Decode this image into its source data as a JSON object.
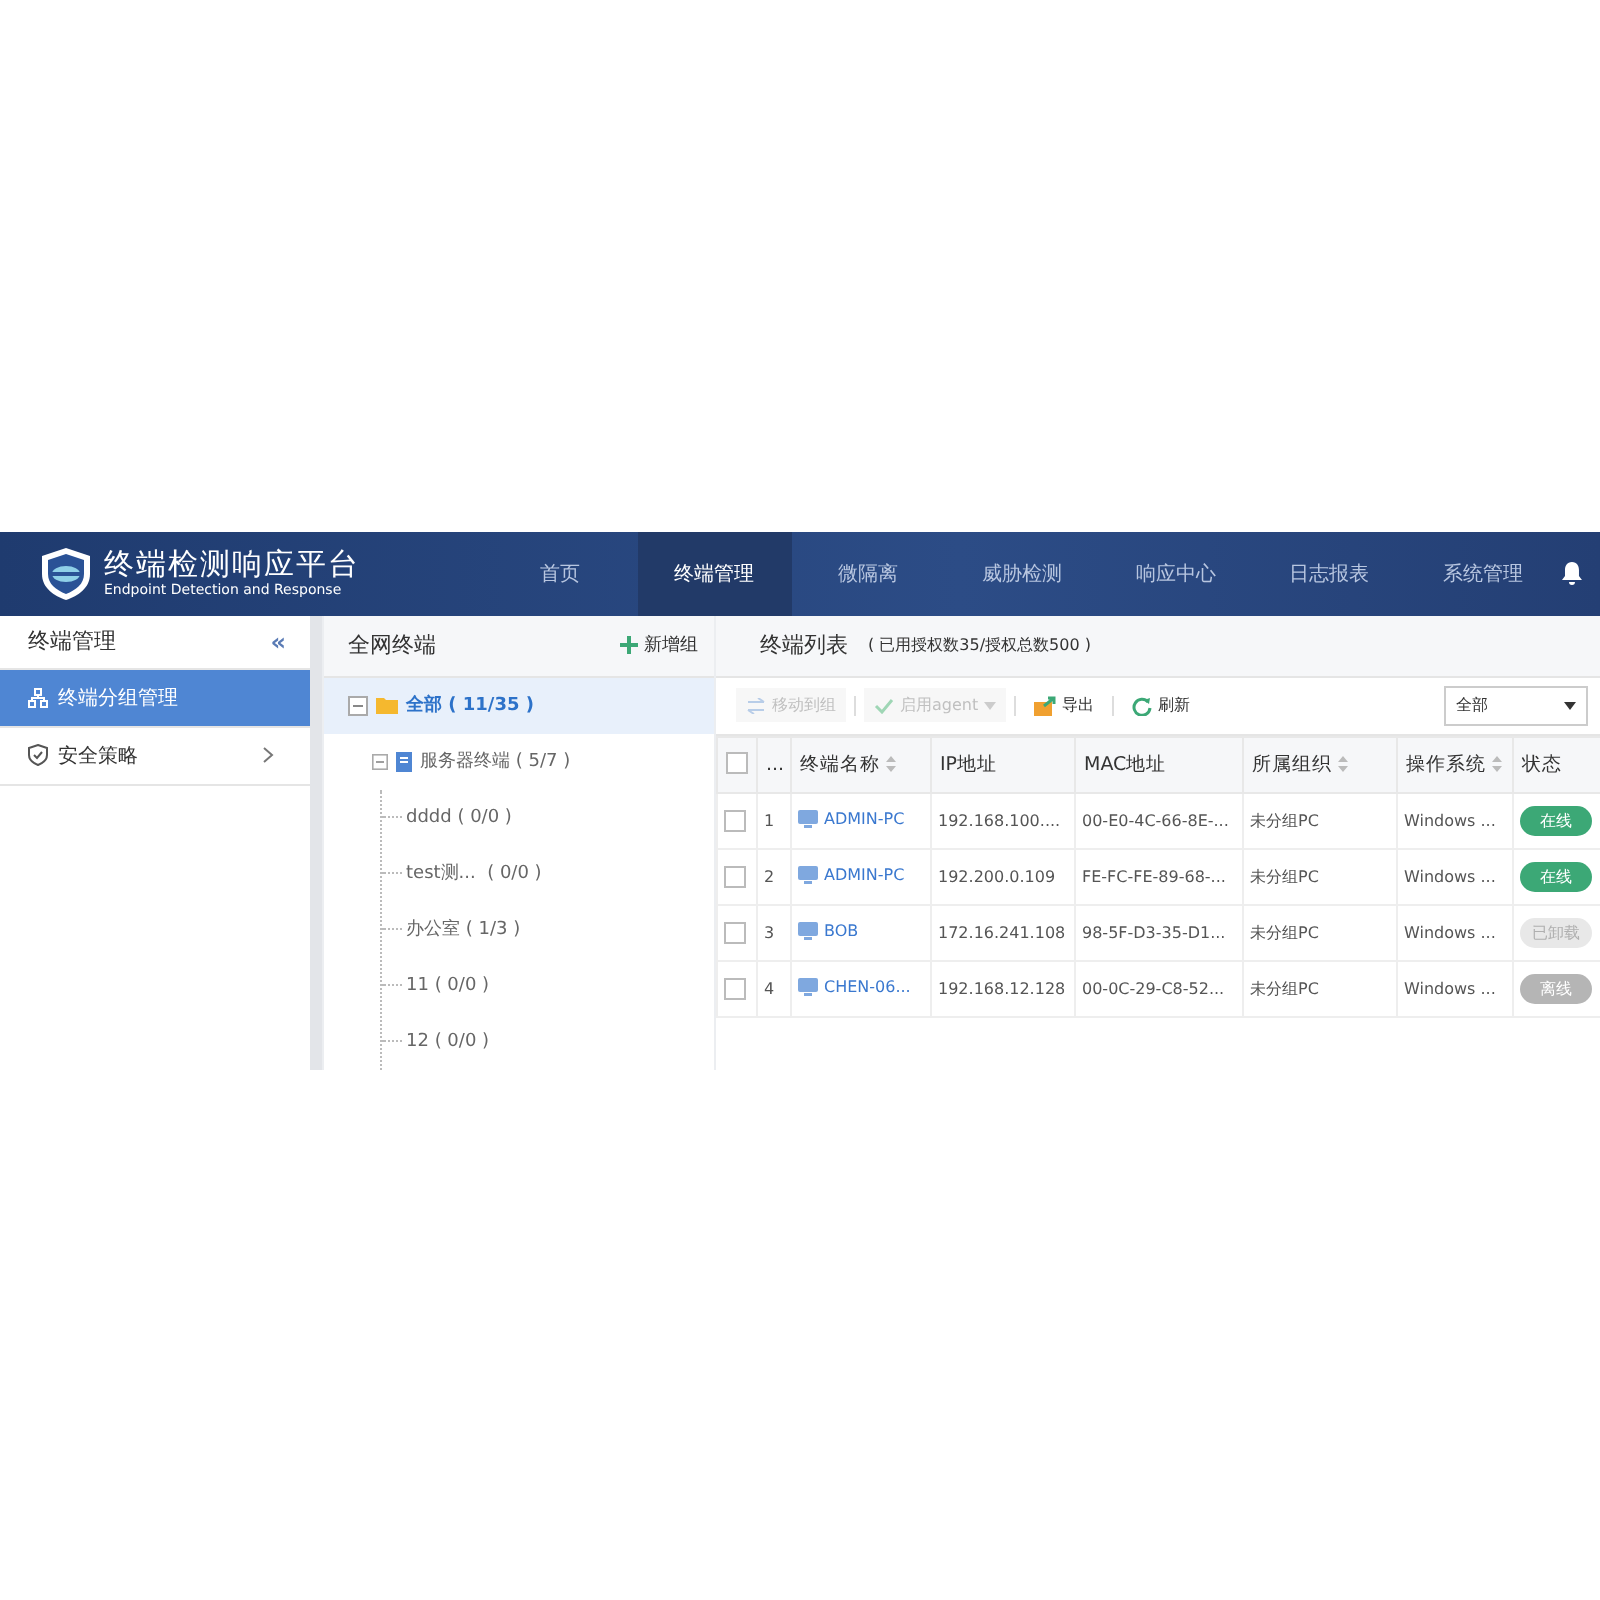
{
  "header": {
    "title": "终端检测响应平台",
    "subtitle": "Endpoint Detection and Response",
    "nav": [
      {
        "label": "首页",
        "selected": false
      },
      {
        "label": "终端管理",
        "selected": true
      },
      {
        "label": "微隔离",
        "selected": false
      },
      {
        "label": "威胁检测",
        "selected": false
      },
      {
        "label": "响应中心",
        "selected": false
      },
      {
        "label": "日志报表",
        "selected": false
      },
      {
        "label": "系统管理",
        "selected": false
      }
    ]
  },
  "sidebar": {
    "title": "终端管理",
    "collapse": "«",
    "items": [
      {
        "label": "终端分组管理",
        "selected": true,
        "expandable": false
      },
      {
        "label": "安全策略",
        "selected": false,
        "expandable": true
      }
    ]
  },
  "tree": {
    "title": "全网终端",
    "add_button": "新增组",
    "root": {
      "label": "全部 ( 11/35 )",
      "selected": true,
      "expanded": true,
      "children": [
        {
          "label": "服务器终端 ( 5/7 )",
          "selected": false,
          "expanded": true,
          "children": [
            {
              "label": "dddd ( 0/0 )",
              "selected": false
            },
            {
              "label": "test测...  ( 0/0 )",
              "selected": false
            },
            {
              "label": "办公室 ( 1/3 )",
              "selected": false
            },
            {
              "label": "11 ( 0/0 )",
              "selected": false
            },
            {
              "label": "12 ( 0/0 )",
              "selected": false
            }
          ]
        }
      ]
    }
  },
  "list": {
    "title": "终端列表",
    "license": "( 已用授权数35/授权总数500 )",
    "toolbar": [
      {
        "label": "移动到组",
        "kind": "move",
        "disabled": true,
        "dropdown": false
      },
      {
        "label": "启用agent",
        "kind": "enable",
        "disabled": true,
        "dropdown": true
      },
      {
        "label": "导出",
        "kind": "export",
        "disabled": false,
        "dropdown": false
      },
      {
        "label": "刷新",
        "kind": "refresh",
        "disabled": false,
        "dropdown": false
      }
    ],
    "filter": "全部",
    "select_all": {
      "checked": false
    },
    "columns": [
      {
        "label": "...",
        "sortable": false
      },
      {
        "label": "终端名称",
        "sortable": true
      },
      {
        "label": "IP地址",
        "sortable": false
      },
      {
        "label": "MAC地址",
        "sortable": false
      },
      {
        "label": "所属组织",
        "sortable": true
      },
      {
        "label": "操作系统",
        "sortable": true
      },
      {
        "label": "状态",
        "sortable": false
      }
    ],
    "rows": [
      {
        "checked": false,
        "index": "1",
        "name": "ADMIN-PC",
        "ip": "192.168.100....",
        "mac": "00-E0-4C-66-8E-...",
        "org": "未分组PC",
        "os": "Windows ...",
        "status": {
          "label": "在线",
          "kind": "online"
        }
      },
      {
        "checked": false,
        "index": "2",
        "name": "ADMIN-PC",
        "ip": "192.200.0.109",
        "mac": "FE-FC-FE-89-68-...",
        "org": "未分组PC",
        "os": "Windows ...",
        "status": {
          "label": "在线",
          "kind": "online"
        }
      },
      {
        "checked": false,
        "index": "3",
        "name": "BOB",
        "ip": "172.16.241.108",
        "mac": "98-5F-D3-35-D1...",
        "org": "未分组PC",
        "os": "Windows ...",
        "status": {
          "label": "已卸载",
          "kind": "uninstalled"
        }
      },
      {
        "checked": false,
        "index": "4",
        "name": "CHEN-06...",
        "ip": "192.168.12.128",
        "mac": "00-0C-29-C8-52...",
        "org": "未分组PC",
        "os": "Windows ...",
        "status": {
          "label": "离线",
          "kind": "offline"
        }
      }
    ]
  }
}
